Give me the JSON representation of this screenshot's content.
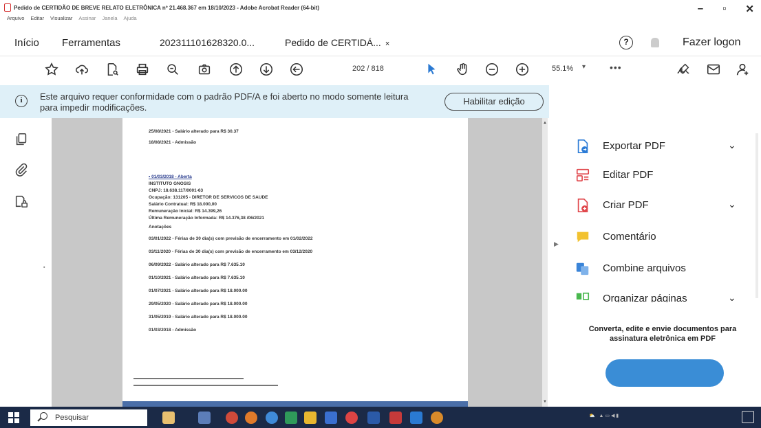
{
  "window": {
    "title": "Pedido de CERTIDÃO DE BREVE RELATO ELETRÔNICA nº 21.468.367 em 18/10/2023 - Adobe Acrobat Reader (64-bit)",
    "menu": [
      "Arquivo",
      "Editar",
      "Visualizar",
      "Assinar",
      "Janela",
      "Ajuda"
    ],
    "controls": {
      "minimize": "–",
      "maximize": "▫",
      "close": "✕"
    }
  },
  "tabs": {
    "home": "Início",
    "tools": "Ferramentas",
    "doc1": "202311101628320.0...",
    "doc2": "Pedido de CERTIDÁ...",
    "doc2_close": "×",
    "help": "?",
    "login": "Fazer logon"
  },
  "toolbar": {
    "page_current": "202",
    "page_total": "/ 818",
    "zoom": "55.1%",
    "more": "•••",
    "icons": [
      "star-icon",
      "upload-icon",
      "file-search-icon",
      "print-icon",
      "zoom-search-icon",
      "camera-icon",
      "arrow-up-circle-icon",
      "arrow-down-circle-icon",
      "arrow-left-circle-icon",
      "cursor-icon",
      "hand-icon",
      "minus-circle-icon",
      "plus-circle-icon",
      "sign-icon",
      "mail-icon",
      "profile-icon"
    ]
  },
  "notice": {
    "message": "Este arquivo requer conformidade com o padrão PDF/A e foi aberto no modo somente leitura para impedir modificações.",
    "button": "Habilitar edição"
  },
  "document": {
    "lines": [
      "25/08/2021 - Salário alterado para R$ 30.37",
      "18/08/2021 - Admissão",
      "• 01/03/2018 - Aberta",
      "INSTITUTO GNOSIS",
      "CNPJ: 18.638.117/0001-63",
      "Ocupação: 131205 - DIRETOR DE SERVICOS DE SAUDE",
      "Salário Contratual:    R$ 18.000,00",
      "Remuneração Inicial:    R$    14.399,26",
      "Última Remuneração Informada:    R$    14.376,38    /06/2021",
      "Anotações",
      "03/01/2022 - Férias de 30 dia(s) com previsão de encerramento em 01/02/2022",
      "03/11/2020 - Férias de 30 dia(s) com previsão de encerramento em 03/12/2020",
      "06/09/2022 - Salário alterado para R$ 7.635.10",
      "01/10/2021 - Salário alterado para R$ 7.635.10",
      "01/07/2021 - Salário alterado para R$ 18.000.00",
      "29/05/2020 - Salário alterado para R$ 18.000.00",
      "31/05/2019 - Salário alterado para R$ 18.000.00",
      "01/03/2018 - Admissão"
    ]
  },
  "tools_panel": {
    "items": [
      {
        "label": "Exportar PDF",
        "icon": "export-pdf-icon",
        "color": "#2b7bd6"
      },
      {
        "label": "Editar PDF",
        "icon": "edit-pdf-icon",
        "color": "#e0464b"
      },
      {
        "label": "Criar PDF",
        "icon": "create-pdf-icon",
        "color": "#e0464b"
      },
      {
        "label": "Comentário",
        "icon": "comment-icon",
        "color": "#f2c230"
      },
      {
        "label": "Combine arquivos",
        "icon": "combine-files-icon",
        "color": "#3a84d8"
      },
      {
        "label": "Organizar páginas",
        "icon": "organize-pages-icon",
        "color": "#49b84e"
      }
    ],
    "promo": "Converta, edite e envie documentos para assinatura eletrônica em PDF"
  },
  "taskbar": {
    "search_placeholder": "Pesquisar"
  }
}
